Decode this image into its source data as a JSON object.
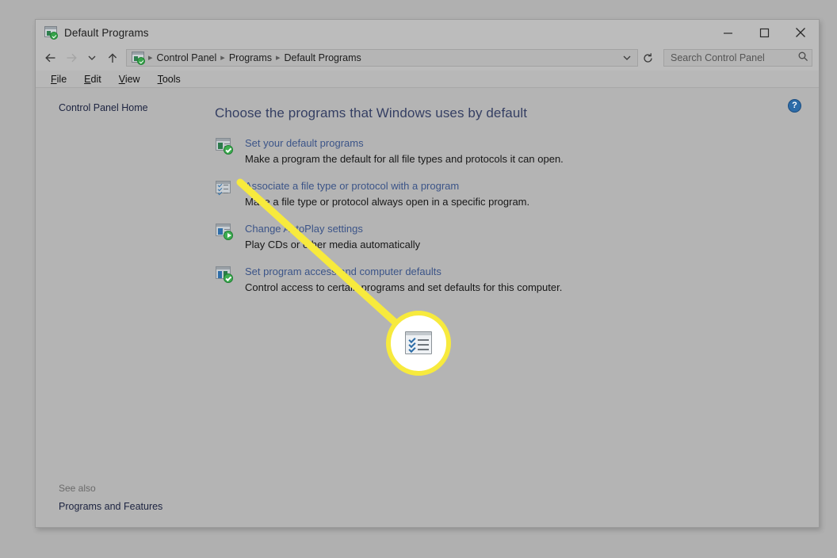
{
  "window": {
    "title": "Default Programs",
    "title_icon": "default-programs-icon",
    "controls": {
      "minimize": "minimize-icon",
      "maximize": "maximize-icon",
      "close": "close-icon"
    }
  },
  "navbar": {
    "back": "back-arrow-icon",
    "forward": "forward-arrow-icon",
    "recent": "history-chevron-icon",
    "up": "up-arrow-icon",
    "breadcrumb": [
      "Control Panel",
      "Programs",
      "Default Programs"
    ],
    "separator": "▸",
    "dropdown": "chevron-down-icon",
    "refresh": "refresh-icon"
  },
  "search": {
    "placeholder": "Search Control Panel",
    "icon": "search-icon"
  },
  "menubar": [
    {
      "label": "File",
      "accesskey": "F"
    },
    {
      "label": "Edit",
      "accesskey": "E"
    },
    {
      "label": "View",
      "accesskey": "V"
    },
    {
      "label": "Tools",
      "accesskey": "T"
    }
  ],
  "sidebar": {
    "home": "Control Panel Home",
    "see_also_label": "See also",
    "see_also_link": "Programs and Features"
  },
  "content": {
    "heading": "Choose the programs that Windows uses by default",
    "help_button": "?",
    "tasks": [
      {
        "icon": "set-default-programs-icon",
        "link": "Set your default programs",
        "description": "Make a program the default for all file types and protocols it can open."
      },
      {
        "icon": "associate-file-type-icon",
        "link": "Associate a file type or protocol with a program",
        "description": "Make a file type or protocol always open in a specific program."
      },
      {
        "icon": "change-autoplay-settings-icon",
        "link": "Change AutoPlay settings",
        "description": "Play CDs or other media automatically"
      },
      {
        "icon": "set-program-access-icon",
        "link": "Set program access and computer defaults",
        "description": "Control access to certain programs and set defaults for this computer."
      }
    ]
  },
  "callout": {
    "highlight_color": "#f7ea3d",
    "icon": "associate-file-type-icon",
    "points_to": "Associate a file type or protocol with a program"
  },
  "colors": {
    "window_chrome": "#bcbcbc",
    "content_bg": "#b4b4b4",
    "heading": "#353f63",
    "link": "#3b5488",
    "highlight": "#f7ea3d",
    "help_blue": "#2d6ca8"
  }
}
